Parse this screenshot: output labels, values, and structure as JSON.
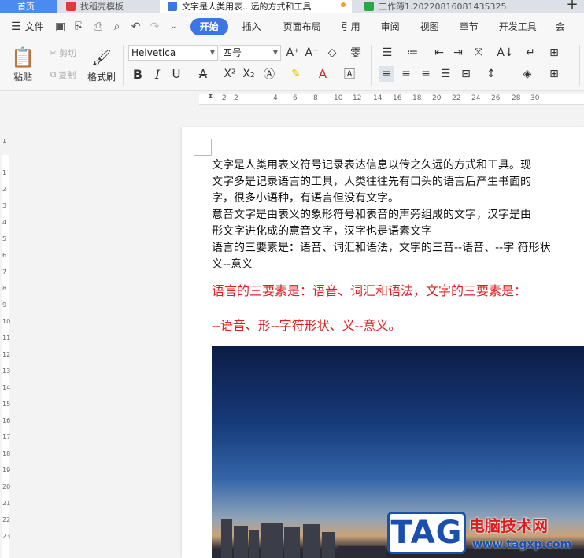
{
  "tabs": [
    {
      "label": "首页"
    },
    {
      "label": "找稻壳模板"
    },
    {
      "label": "文字是人类用表...远的方式和工具"
    },
    {
      "label": "工作簿1.20220816081435325"
    }
  ],
  "menu": {
    "file_label": "文件",
    "tabs": [
      "开始",
      "插入",
      "页面布局",
      "引用",
      "审阅",
      "视图",
      "章节",
      "开发工具",
      "会"
    ]
  },
  "ribbon": {
    "paste_label": "粘贴",
    "cut_label": "剪切",
    "copy_label": "复制",
    "format_painter_label": "格式刷",
    "font_name": "Helvetica",
    "font_size": "四号"
  },
  "ruler": {
    "h_ticks": [
      "2",
      "2",
      "4",
      "6",
      "8",
      "10",
      "12",
      "14",
      "16",
      "18",
      "20",
      "22",
      "24",
      "26",
      "28",
      "30"
    ],
    "v_ticks": [
      "1",
      "1",
      "2",
      "3",
      "4",
      "5",
      "6",
      "7",
      "8",
      "9",
      "10",
      "11",
      "12",
      "13",
      "14",
      "15",
      "16",
      "17",
      "18",
      "19",
      "20",
      "21",
      "22",
      "23"
    ]
  },
  "document": {
    "paragraphs": [
      "文字是人类用表义符号记录表达信息以传之久远的方式和工具。现",
      "文字多是记录语言的工具，人类往往先有口头的语言后产生书面的",
      "字，很多小语种，有语言但没有文字。",
      "意音文字是由表义的象形符号和表音的声旁组成的文字，汉字是由",
      "形文字进化成的意音文字，汉字也是语素文字",
      "语言的三要素是：语音、词汇和语法，文字的三音--语音、--字 符形状",
      "义--意义"
    ],
    "red_lines": [
      "语言的三要素是：语音、词汇和语法，文字的三要素是：",
      "--语音、形--字符形状、义--意义。"
    ]
  },
  "watermark": {
    "logo_text": "TAG",
    "site_name": "电脑技术网",
    "url": "www.tagxp.com"
  }
}
